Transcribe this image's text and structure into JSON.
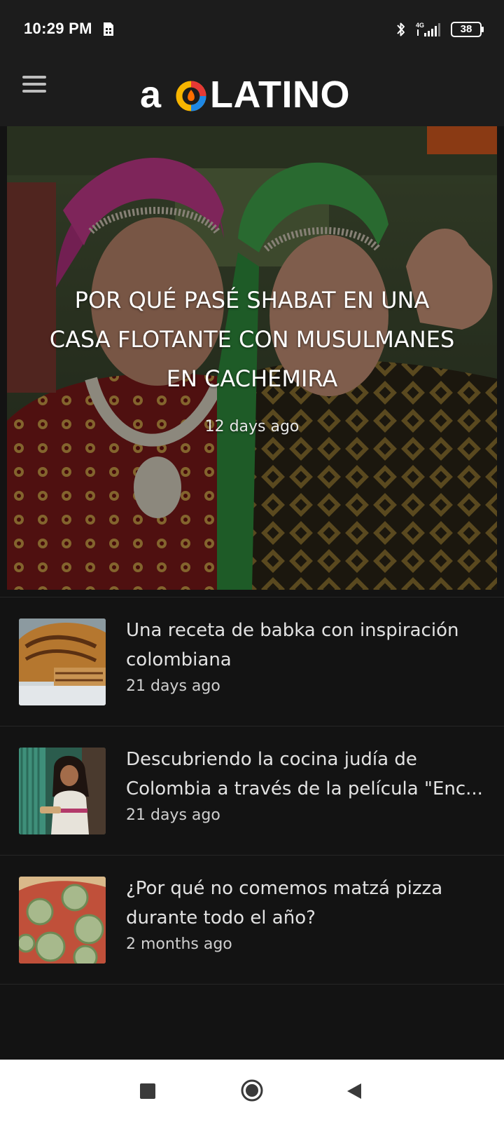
{
  "status_bar": {
    "time": "10:29 PM",
    "battery": "38",
    "network": "4G",
    "icons": [
      "sim-card-icon",
      "bluetooth-icon",
      "signal-icon",
      "battery-icon"
    ]
  },
  "header": {
    "logo_text": "a LATINO",
    "logo_text_before": "a",
    "logo_text_after": "LATINO",
    "menu_icon": "hamburger-menu-icon"
  },
  "hero": {
    "title": "POR QUÉ PASÉ SHABAT EN UNA CASA FLOTANTE CON MUSULMANES EN CACHEMIRA",
    "time": "12 days ago"
  },
  "articles": [
    {
      "title": "Una receta de babka con inspiración colombiana",
      "time": "21 days ago"
    },
    {
      "title": "Descubriendo la cocina judía de Colombia a través de la película \"Enc...",
      "time": "21 days ago"
    },
    {
      "title": "¿Por qué no comemos matzá pizza durante todo el año?",
      "time": "2 months ago"
    }
  ],
  "nav": {
    "recent_icon": "recent-apps-icon",
    "home_icon": "home-icon",
    "back_icon": "back-icon"
  },
  "colors": {
    "background": "#131313",
    "header": "#1c1c1c",
    "text": "#e2e2e2",
    "nav_bar": "#ffffff"
  }
}
